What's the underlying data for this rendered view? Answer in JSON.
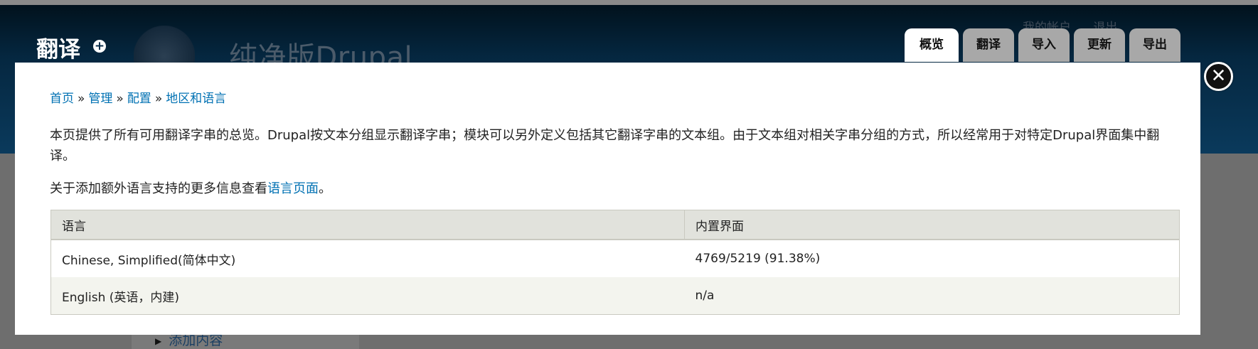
{
  "header": {
    "page_title": "翻译",
    "shortcut_glyph": "+",
    "site_name": "纯净版Drupal",
    "secondary_links": [
      "我的帐户",
      "退出"
    ],
    "tabs": [
      {
        "label": "概览",
        "active": true
      },
      {
        "label": "翻译",
        "active": false
      },
      {
        "label": "导入",
        "active": false
      },
      {
        "label": "更新",
        "active": false
      },
      {
        "label": "导出",
        "active": false
      }
    ]
  },
  "overlay": {
    "close_glyph": "✕",
    "breadcrumb": [
      "首页",
      "管理",
      "配置",
      "地区和语言"
    ],
    "breadcrumb_separator": "»",
    "description": "本页提供了所有可用翻译字串的总览。Drupal按文本分组显示翻译字串；模块可以另外定义包括其它翻译字串的文本组。由于文本组对相关字串分组的方式，所以经常用于对特定Drupal界面集中翻译。",
    "more_info_prefix": "关于添加额外语言支持的更多信息查看",
    "more_info_link": "语言页面",
    "more_info_suffix": "。",
    "table": {
      "headers": [
        "语言",
        "内置界面"
      ],
      "rows": [
        [
          "Chinese, Simplified(简体中文)",
          "4769/5219 (91.38%)"
        ],
        [
          "English (英语，内建)",
          "n/a"
        ]
      ]
    }
  },
  "background": {
    "sidebar_link": "添加内容"
  },
  "colors": {
    "header_dark": "#01121d",
    "header_light": "#0a3a5c",
    "link": "#0071b3",
    "table_header": "#e1e2dc",
    "table_even_row": "#f3f4ee",
    "tab_inactive": "#a8a8a8"
  }
}
